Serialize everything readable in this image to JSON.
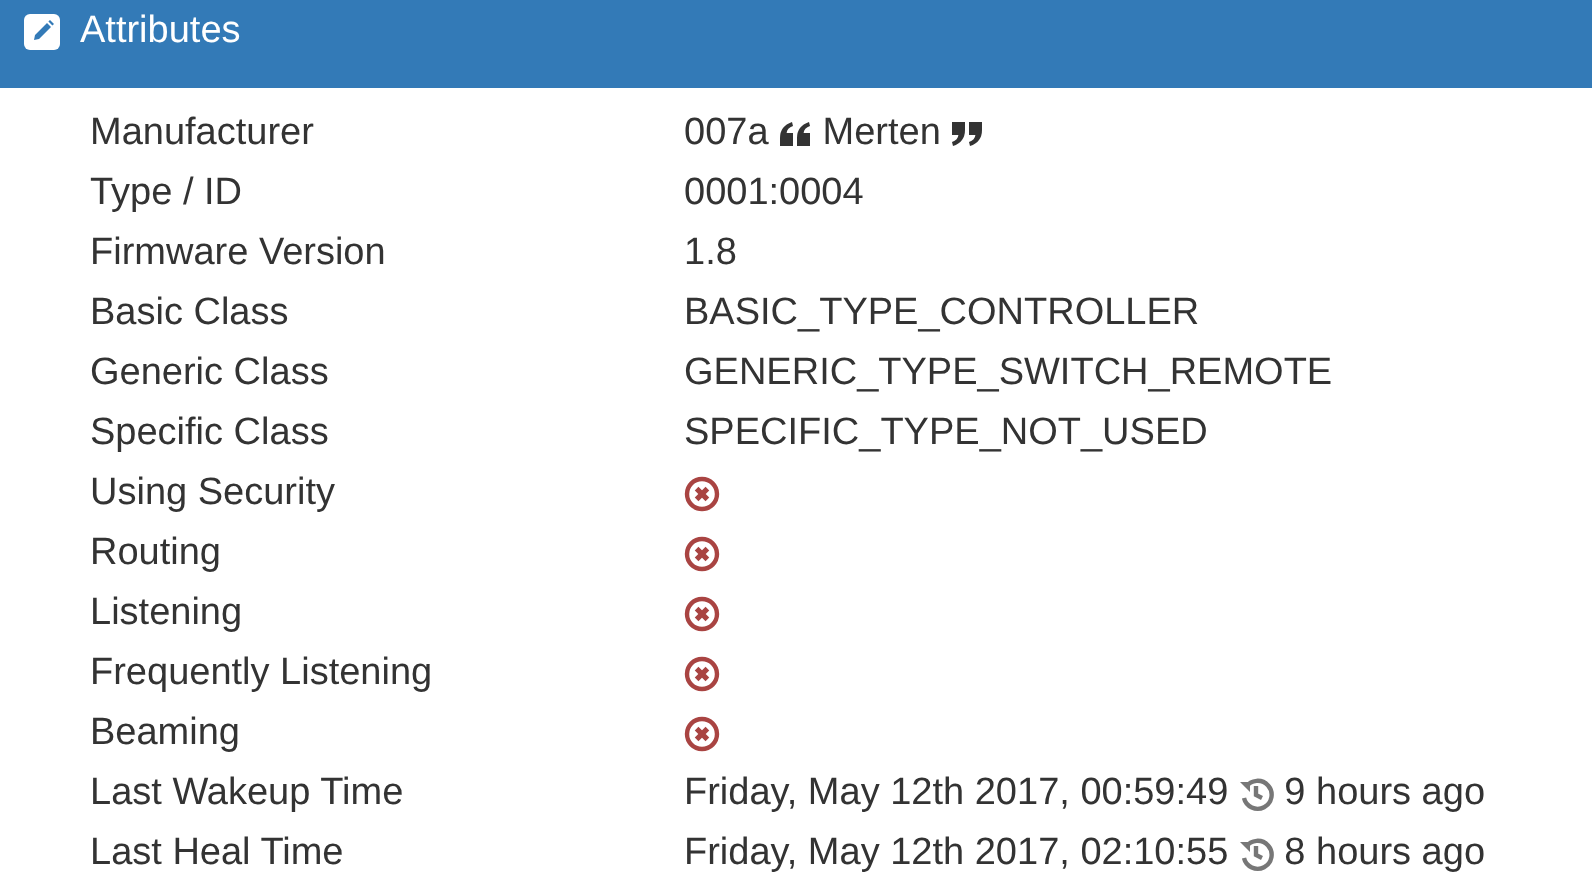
{
  "panel": {
    "title": "Attributes"
  },
  "rows": [
    {
      "label": "Manufacturer",
      "kind": "manufacturer",
      "code": "007a",
      "name": "Merten"
    },
    {
      "label": "Type / ID",
      "kind": "text",
      "value": "0001:0004"
    },
    {
      "label": "Firmware Version",
      "kind": "text",
      "value": "1.8"
    },
    {
      "label": "Basic Class",
      "kind": "text",
      "value": "BASIC_TYPE_CONTROLLER"
    },
    {
      "label": "Generic Class",
      "kind": "text",
      "value": "GENERIC_TYPE_SWITCH_REMOTE"
    },
    {
      "label": "Specific Class",
      "kind": "text",
      "value": "SPECIFIC_TYPE_NOT_USED"
    },
    {
      "label": "Using Security",
      "kind": "flag",
      "on": false
    },
    {
      "label": "Routing",
      "kind": "flag",
      "on": false
    },
    {
      "label": "Listening",
      "kind": "flag",
      "on": false
    },
    {
      "label": "Frequently Listening",
      "kind": "flag",
      "on": false
    },
    {
      "label": "Beaming",
      "kind": "flag",
      "on": false
    },
    {
      "label": "Last Wakeup Time",
      "kind": "time",
      "value": "Friday, May 12th 2017, 00:59:49",
      "ago": "9 hours ago"
    },
    {
      "label": "Last Heal Time",
      "kind": "time",
      "value": "Friday, May 12th 2017, 02:10:55",
      "ago": "8 hours ago"
    }
  ]
}
